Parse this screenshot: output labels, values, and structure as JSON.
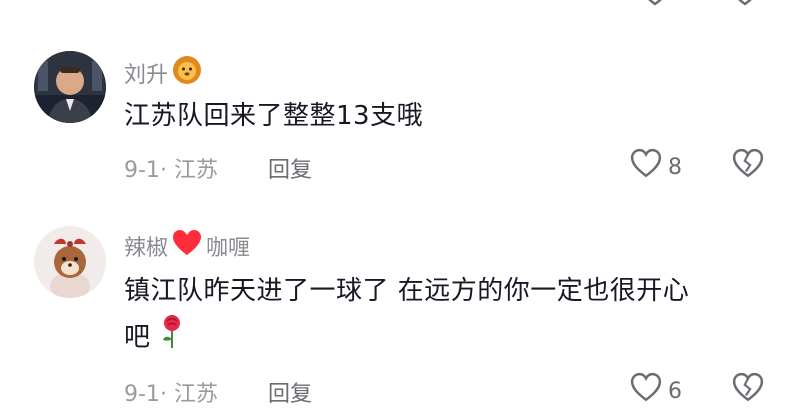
{
  "comments": [
    {
      "username": "刘升",
      "username_suffix": "",
      "badge_icon": "lion-emoji-icon",
      "text": "江苏队回来了整整13支哦",
      "text_tail": "",
      "date": "9-1",
      "location": "江苏",
      "reply_label": "回复",
      "likes": "8"
    },
    {
      "username": "辣椒",
      "username_suffix": "咖喱",
      "badge_icon": "red-heart-emoji-icon",
      "text": "镇江队昨天进了一球了  在远方的你一定也很开心",
      "text_tail": "吧",
      "tail_icon": "rose-emoji-icon",
      "date": "9-1",
      "location": "江苏",
      "reply_label": "回复",
      "likes": "6"
    }
  ],
  "colors": {
    "text": "#161823",
    "meta": "#9a9aa0",
    "heart": "#ff2d55"
  }
}
